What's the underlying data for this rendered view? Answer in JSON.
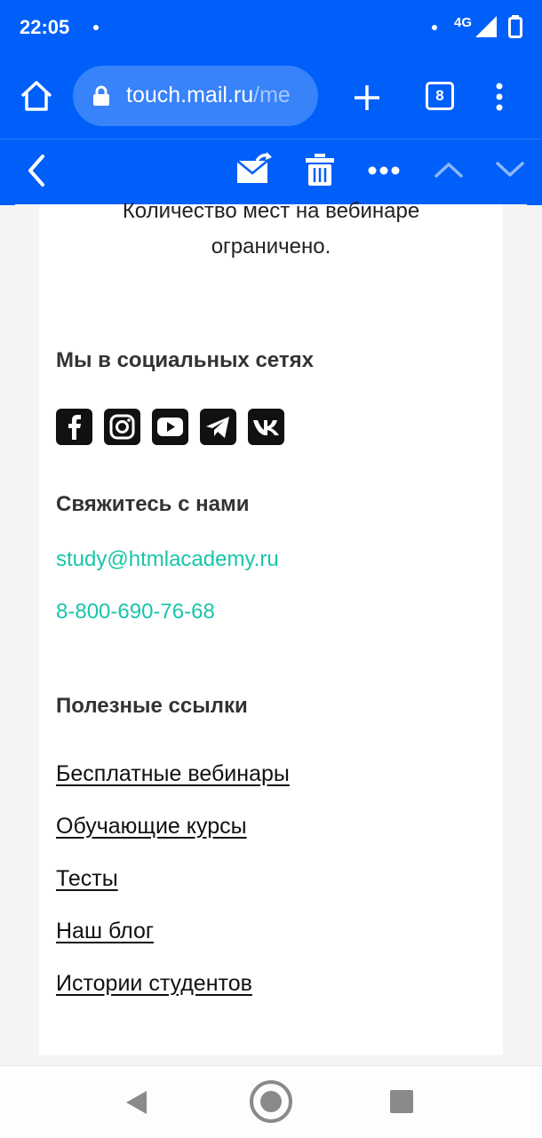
{
  "status_bar": {
    "time": "22:05",
    "network": "4G"
  },
  "browser": {
    "url_main": "touch.mail.ru",
    "url_rest": "/me",
    "tab_count": "8"
  },
  "mail_toolbar": {
    "icons": [
      "back-chevron-icon",
      "move-mail-icon",
      "trash-icon",
      "more-dots-icon",
      "chevron-up-icon",
      "chevron-down-icon"
    ]
  },
  "email": {
    "intro_line1": "Количество мест на вебинаре",
    "intro_line2": "ограничено.",
    "social_heading": "Мы в социальных сетях",
    "social_icons": [
      "facebook-icon",
      "instagram-icon",
      "youtube-icon",
      "telegram-icon",
      "vk-icon"
    ],
    "contact_heading": "Свяжитесь с нами",
    "email": "study@htmlacademy.ru",
    "phone": "8-800-690-76-68",
    "links_heading": "Полезные ссылки",
    "links": [
      "Бесплатные вебинары",
      "Обучающие курсы",
      "Тесты",
      "Наш блог",
      "Истории студентов"
    ]
  },
  "colors": {
    "brand_blue": "#005ff9",
    "link_teal": "#19c5a9"
  }
}
